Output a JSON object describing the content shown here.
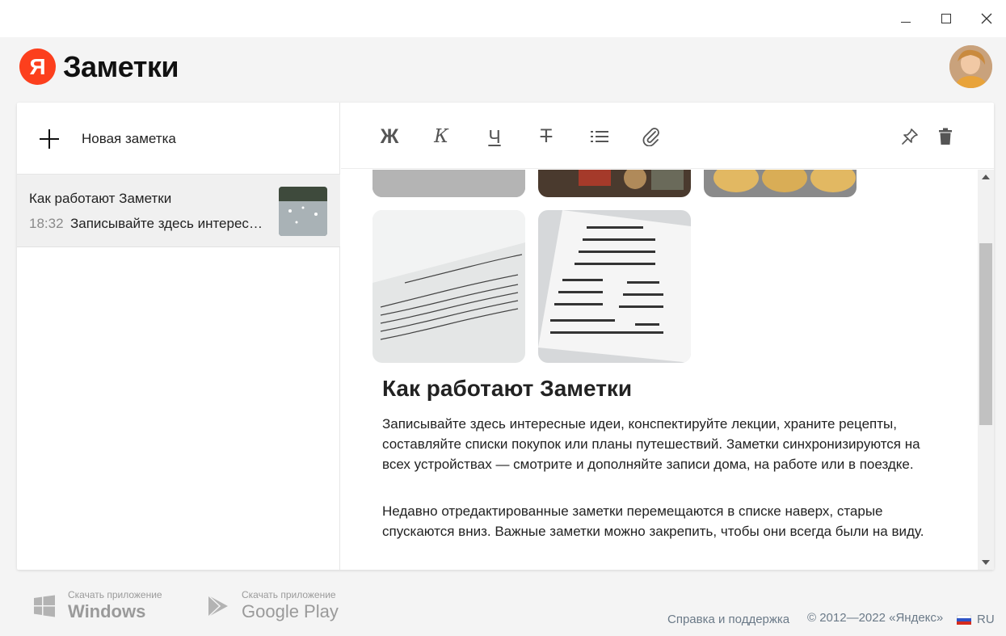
{
  "app": {
    "title": "Заметки",
    "logo_letter": "Я"
  },
  "sidebar": {
    "new_note_label": "Новая заметка",
    "notes": [
      {
        "title": "Как работают Заметки",
        "time": "18:32",
        "snippet": "Записывайте здесь интересные идеи, конспектируйте лекции"
      }
    ]
  },
  "toolbar": {
    "bold": "Ж",
    "italic": "К",
    "underline": "Ч",
    "strike": "Т"
  },
  "note": {
    "title": "Как работают Заметки",
    "paragraphs": [
      "Записывайте здесь интересные идеи, конспектируйте лекции, храните рецепты, составляйте списки покупок или планы путешествий. Заметки синхронизируются на всех устройствах — смотрите и дополняйте записи дома, на работе или в поездке.",
      "Недавно отредактированные заметки перемещаются в списке наверх, старые спускаются вниз. Важные заметки можно закрепить, чтобы они всегда были на виду."
    ]
  },
  "footer": {
    "windows": {
      "small": "Скачать приложение",
      "big": "Windows"
    },
    "google_play": {
      "small": "Скачать приложение",
      "big": "Google Play"
    },
    "help": "Справка и поддержка",
    "copyright": "© 2012—2022 «Яндекс»",
    "lang": "RU"
  },
  "colors": {
    "brand": "#fc3f1d",
    "footer_text": "#6b7a88"
  }
}
